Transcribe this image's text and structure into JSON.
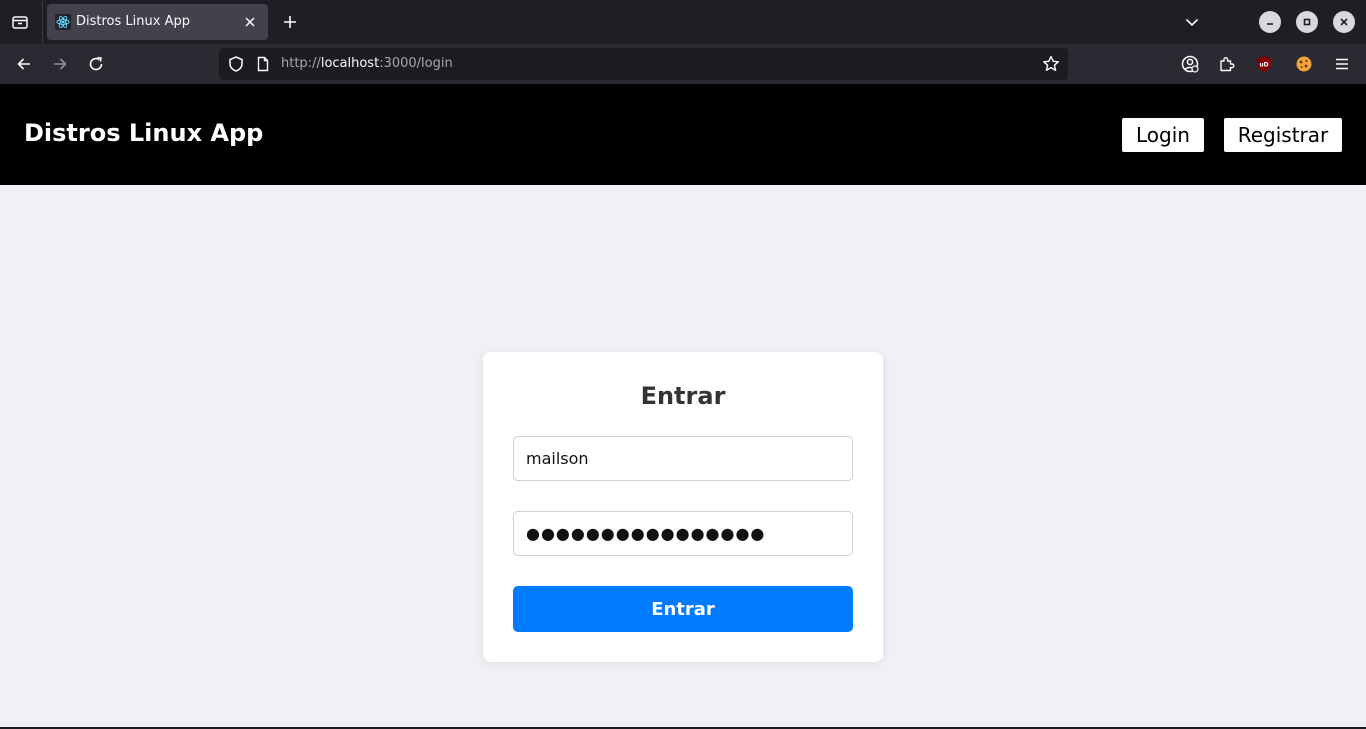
{
  "browser": {
    "tab": {
      "title": "Distros Linux App"
    },
    "url": {
      "scheme": "http://",
      "host": "localhost",
      "rest": ":3000/login"
    },
    "icons": {
      "tab_list": "tab-list-icon",
      "tab_favicon": "react-icon",
      "tab_close": "close-icon",
      "new_tab": "plus-icon",
      "tabs_menu": "chevron-down-icon",
      "minimize": "minimize-icon",
      "maximize": "maximize-icon",
      "close_window": "close-icon",
      "back": "arrow-left-icon",
      "forward": "arrow-right-icon",
      "reload": "reload-icon",
      "tracking_protection": "shield-icon",
      "page_info": "page-icon",
      "bookmark": "star-icon",
      "account": "account-icon",
      "extensions": "puzzle-icon",
      "ublock": "ublock-icon",
      "extension_2": "cookie-icon",
      "menu": "hamburger-icon"
    }
  },
  "header": {
    "brand": "Distros Linux App",
    "login_label": "Login",
    "register_label": "Registrar"
  },
  "login_form": {
    "title": "Entrar",
    "username_value": "mailson",
    "password_masked": "●●●●●●●●●●●●●●●●",
    "submit_label": "Entrar"
  },
  "colors": {
    "header_bg": "#000000",
    "page_bg": "#f0f1f5",
    "primary": "#007bff",
    "card_bg": "#ffffff"
  }
}
